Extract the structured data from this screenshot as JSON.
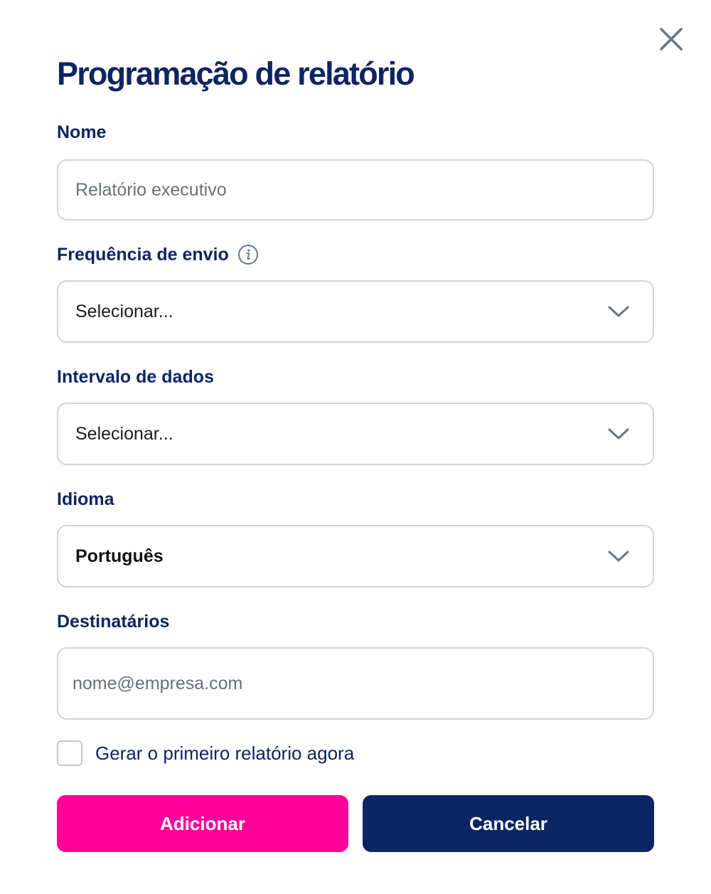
{
  "dialog": {
    "title": "Programação de relatório"
  },
  "fields": {
    "nome": {
      "label": "Nome",
      "placeholder": "Relatório executivo"
    },
    "frequencia": {
      "label": "Frequência de envio",
      "value": "Selecionar..."
    },
    "intervalo": {
      "label": "Intervalo de dados",
      "value": "Selecionar..."
    },
    "idioma": {
      "label": "Idioma",
      "value": "Português"
    },
    "destinatarios": {
      "label": "Destinatários",
      "placeholder": "nome@empresa.com"
    }
  },
  "checkbox": {
    "label": "Gerar o primeiro relatório agora",
    "checked": false
  },
  "buttons": {
    "add_label": "Adicionar",
    "cancel_label": "Cancelar"
  },
  "colors": {
    "primary_navy": "#0e2563",
    "accent_pink": "#ff0099",
    "border_gray": "#d2d4d8",
    "icon_gray": "#6b7585"
  },
  "icons": {
    "close": "close-icon",
    "info": "info-icon",
    "chevron": "chevron-down-icon"
  }
}
